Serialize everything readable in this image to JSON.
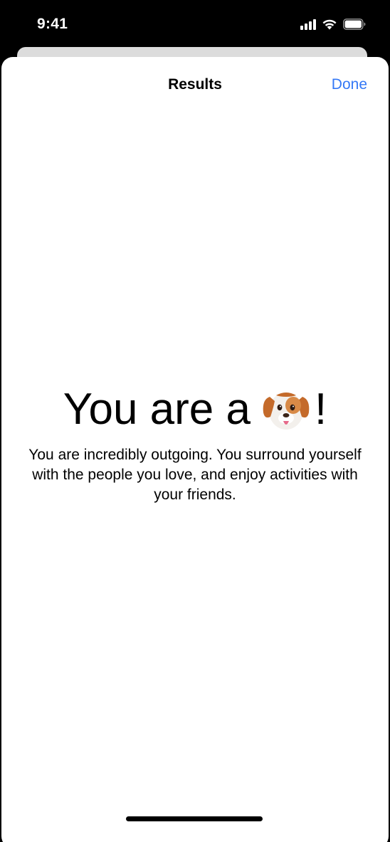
{
  "status_bar": {
    "time": "9:41",
    "icons": [
      "signal-icon",
      "wifi-icon",
      "battery-icon"
    ]
  },
  "nav": {
    "title": "Results",
    "done_label": "Done"
  },
  "result": {
    "headline_prefix": "You are a",
    "emoji": "dog-face-icon",
    "headline_suffix": "!",
    "description": "You are incredibly outgoing. You surround yourself with the people you love, and enjoy activities with your friends."
  },
  "colors": {
    "accent": "#3478f6",
    "background": "#ffffff",
    "status_bar_bg": "#000000"
  }
}
